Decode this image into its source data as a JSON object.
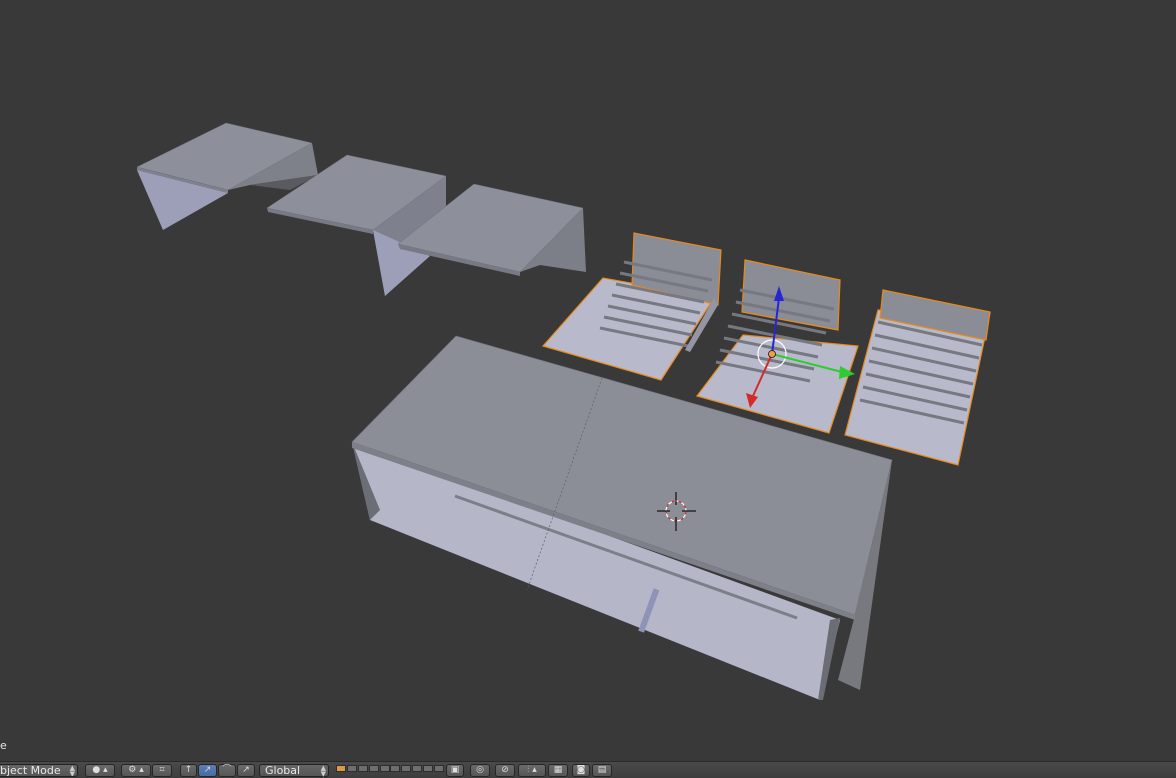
{
  "viewport": {
    "object_name": "e",
    "background": "#393939",
    "selection_outline_color": "#e88a1c",
    "mesh_color": "#a5a7b3",
    "icons": [
      "3d-cursor-icon",
      "transform-manipulator-icon"
    ]
  },
  "header": {
    "mode_label": "bject Mode",
    "orientation_label": "Global",
    "icons": [
      "viewport-shading-icon",
      "pivot-point-icon",
      "manipulator-toggle-icon",
      "translate-icon",
      "rotate-icon",
      "scale-icon",
      "layers-icon",
      "proportional-edit-icon",
      "snap-icon",
      "render-icon"
    ]
  }
}
